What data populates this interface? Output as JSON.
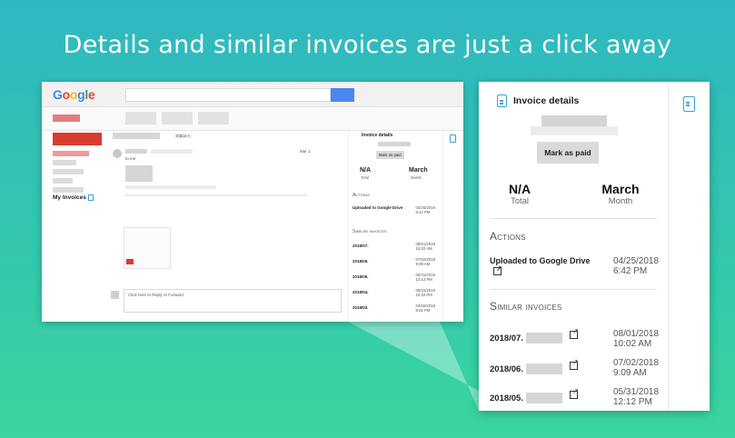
{
  "headline": "Details and similar invoices are just a click away",
  "gmail": {
    "logo": "Google",
    "my_invoices": "My Invoices",
    "inbox_tag": "Inbox ×",
    "to_me": "to me",
    "date_mini": "Mar 1",
    "reply_text": "Click here to Reply or Forward",
    "panel": {
      "title": "Invoice details",
      "mark_label": "Mark as paid",
      "total_value": "N/A",
      "total_label": "Total",
      "month_value": "March",
      "month_label": "Month",
      "actions_heading": "Actions",
      "action_name": "Uploaded to Google Drive",
      "action_date": "04/25/2018",
      "action_time": "6:42 PM",
      "similar_heading": "Similar invoices",
      "similar": [
        {
          "name": "2018/07.",
          "date": "08/01/2018",
          "time": "10:02 AM"
        },
        {
          "name": "2018/06.",
          "date": "07/02/2018",
          "time": "9:09 AM"
        },
        {
          "name": "2018/05.",
          "date": "05/31/2018",
          "time": "12:12 PM"
        },
        {
          "name": "2018/04.",
          "date": "05/01/2018",
          "time": "10:33 PM"
        },
        {
          "name": "2018/03.",
          "date": "04/02/2018",
          "time": "9:02 PM"
        }
      ]
    }
  },
  "zoom": {
    "title": "Invoice details",
    "mark_label": "Mark as paid",
    "total_value": "N/A",
    "total_label": "Total",
    "month_value": "March",
    "month_label": "Month",
    "actions_heading": "Actions",
    "action_name": "Uploaded to Google Drive",
    "action_date": "04/25/2018",
    "action_time": "6:42 PM",
    "similar_heading": "Similar invoices",
    "similar": [
      {
        "name": "2018/07.",
        "date": "08/01/2018",
        "time": "10:02 AM"
      },
      {
        "name": "2018/06.",
        "date": "07/02/2018",
        "time": "9:09 AM"
      },
      {
        "name": "2018/05.",
        "date": "05/31/2018",
        "time": "12:12 PM"
      }
    ]
  },
  "colors": {
    "accent": "#3aa0d5",
    "gmail_red": "#d93b30",
    "search_blue": "#4a87ee"
  },
  "icons": [
    "document-icon",
    "external-link-icon"
  ]
}
